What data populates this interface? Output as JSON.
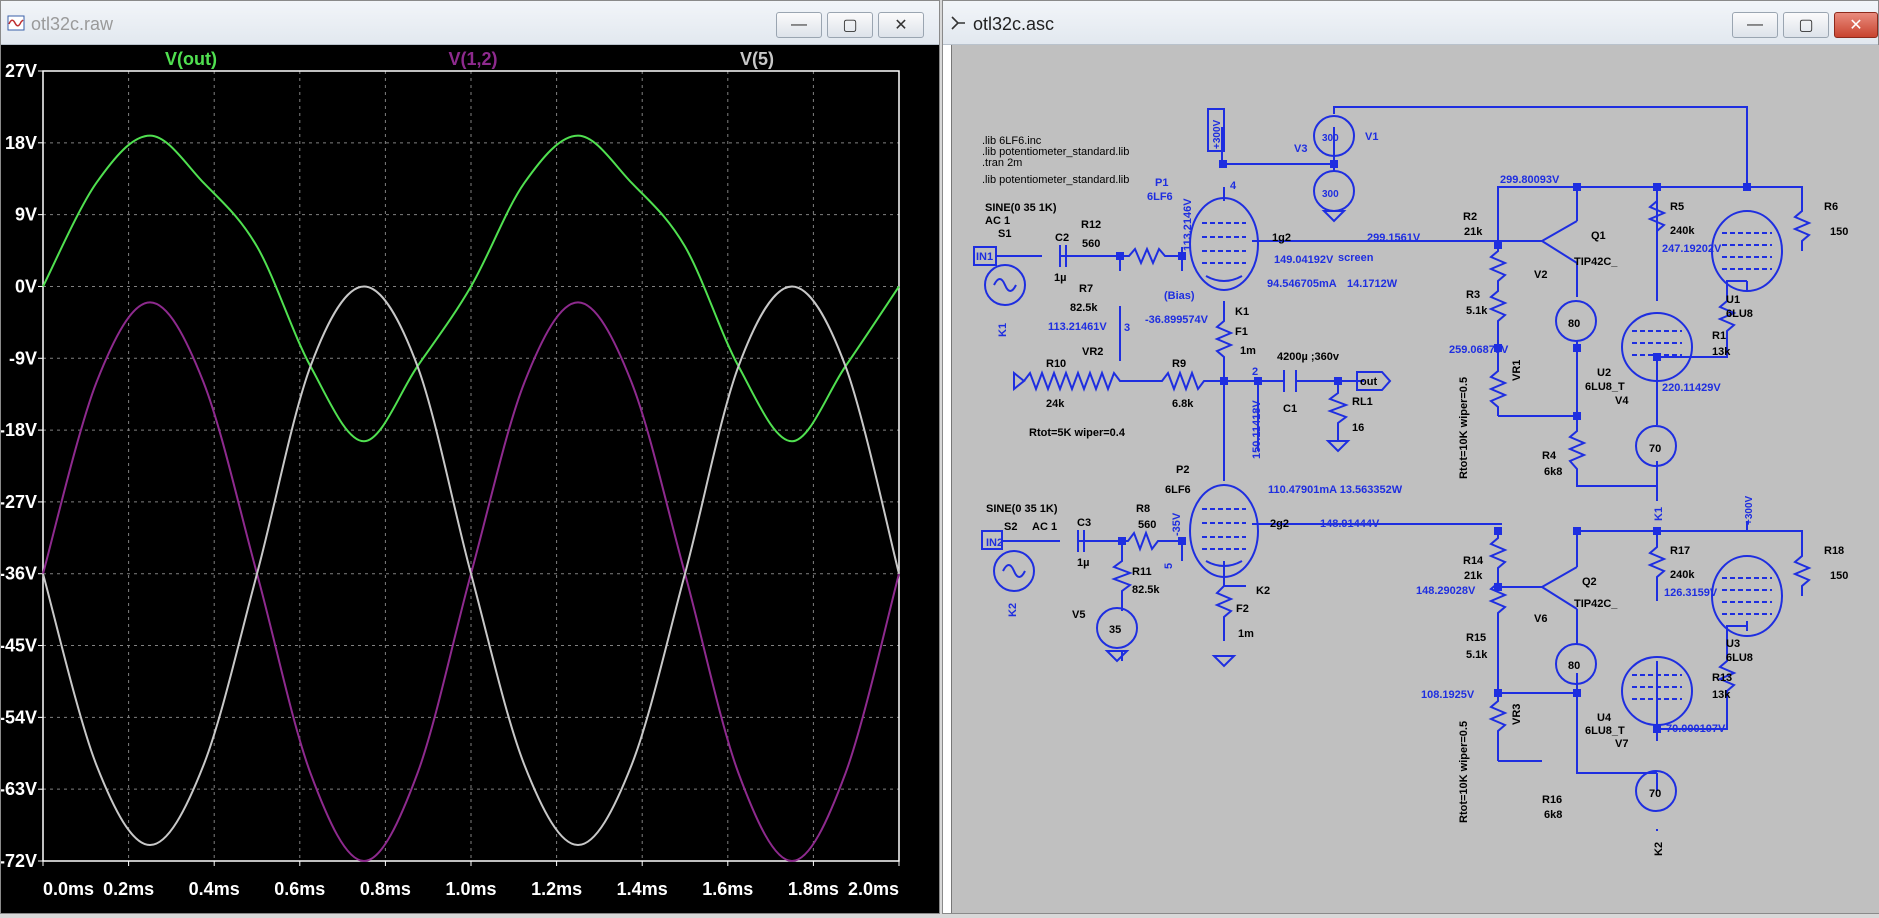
{
  "plot_window": {
    "title": "otl32c.raw",
    "buttons": {
      "minimize": "—",
      "maximize": "▢",
      "close": "✕"
    }
  },
  "schematic_window": {
    "title": "otl32c.asc",
    "buttons": {
      "minimize": "—",
      "maximize": "▢",
      "close": "✕"
    }
  },
  "chart_data": {
    "type": "line",
    "xlabel": "",
    "ylabel": "",
    "xlim": [
      0.0,
      2.0
    ],
    "ylim": [
      -72,
      27
    ],
    "x_tick_labels": [
      "0.0ms",
      "0.2ms",
      "0.4ms",
      "0.6ms",
      "0.8ms",
      "1.0ms",
      "1.2ms",
      "1.4ms",
      "1.6ms",
      "1.8ms",
      "2.0ms"
    ],
    "y_tick_labels": [
      "27V",
      "18V",
      "9V",
      "0V",
      "-9V",
      "-18V",
      "-27V",
      "-36V",
      "-45V",
      "-54V",
      "-63V",
      "-72V"
    ],
    "grid": true,
    "background": "#000000",
    "series": [
      {
        "name": "V(out)",
        "color": "#50e050",
        "x": [
          0.0,
          0.125,
          0.25,
          0.375,
          0.5,
          0.625,
          0.75,
          0.875,
          1.0,
          1.125,
          1.25,
          1.375,
          1.5,
          1.625,
          1.75,
          1.875,
          2.0
        ],
        "values": [
          0,
          13,
          18.9,
          13,
          5,
          -10,
          -19.4,
          -10,
          0,
          13,
          18.9,
          13,
          5,
          -10,
          -19.4,
          -10,
          0
        ]
      },
      {
        "name": "V(1,2)",
        "color": "#8e2a8e",
        "x": [
          0.0,
          0.125,
          0.25,
          0.375,
          0.5,
          0.625,
          0.75,
          0.875,
          1.0,
          1.125,
          1.25,
          1.375,
          1.5,
          1.625,
          1.75,
          1.875,
          2.0
        ],
        "values": [
          -36,
          -12,
          -2,
          -12,
          -36,
          -61,
          -72,
          -61,
          -36,
          -12,
          -2,
          -12,
          -36,
          -61,
          -72,
          -61,
          -36
        ]
      },
      {
        "name": "V(5)",
        "color": "#c8c8c8",
        "x": [
          0.0,
          0.125,
          0.25,
          0.375,
          0.5,
          0.625,
          0.75,
          0.875,
          1.0,
          1.125,
          1.25,
          1.375,
          1.5,
          1.625,
          1.75,
          1.875,
          2.0
        ],
        "values": [
          -36,
          -60,
          -70,
          -60,
          -36,
          -10,
          0,
          -10,
          -36,
          -60,
          -70,
          -60,
          -36,
          -10,
          0,
          -10,
          -36
        ]
      }
    ]
  },
  "schematic": {
    "directives": [
      ".lib 6LF6.inc",
      ".lib potentiometer_standard.lib",
      ".tran 2m",
      ".lib potentiometer_standard.lib"
    ],
    "components": {
      "v1": "V1",
      "v1_val": "300",
      "v3": "V3",
      "v3_val": "300",
      "v300_flag": "+300V",
      "node4": "4",
      "p1": "P1",
      "p1_model": "6LF6",
      "p1_volt": "113.2146V",
      "bias": "(Bias)",
      "sine1": "SINE(0 35 1K)",
      "ac1": "AC 1",
      "s1": "S1",
      "in1": "IN1",
      "k1_flag": "K1",
      "c2": "C2",
      "c2_val": "1µ",
      "r12": "R12",
      "r12_val": "560",
      "r7": "R7",
      "r7_val": "82.5k",
      "v_113": "113.21461V",
      "node3": "3",
      "v_neg36": "-36.899574V",
      "vr2": "VR2",
      "r10": "R10",
      "r10_val": "24k",
      "r9": "R9",
      "r9_val": "6.8k",
      "rtot5k": "Rtot=5K wiper=0.4",
      "g1": "1g2",
      "v_299": "299.1561V",
      "v_149": "149.04192V",
      "screen": "screen",
      "i_94": "94.546705mA",
      "w_14": "14.1712W",
      "k1": "K1",
      "f1": "F1",
      "f1_val": "1m",
      "c1_label": "4200µ ;360v",
      "c1": "C1",
      "node2": "2",
      "out": "out",
      "rl1": "RL1",
      "rl1_val": "16",
      "v_150": "150.11418V",
      "p2": "P2",
      "p2_model": "6LF6",
      "i_110": "110.47901mA 13.563352W",
      "sine2": "SINE(0 35 1K)",
      "s2": "S2",
      "ac2": "AC 1",
      "in2": "IN2",
      "k2_flag": "K2",
      "c3": "C3",
      "c3_val": "1µ",
      "r8": "R8",
      "r8_val": "560",
      "neg35": "-35V",
      "r11": "R11",
      "r11_val": "82.5k",
      "v5": "V5",
      "v5_val": "35",
      "node5": "5",
      "g2": "2g2",
      "v_148": "148.91444V",
      "k2": "K2",
      "f2": "F2",
      "f2_val": "1m",
      "v_29980": "299.80093V",
      "r2": "R2",
      "r2_val": "21k",
      "q1": "Q1",
      "tip1": "TIP42C_",
      "v2": "V2",
      "r3": "R3",
      "r3_val": "5.1k",
      "v80a": "80",
      "v_259": "259.06879V",
      "vr1": "VR1",
      "rtot10k_a": "Rtot=10K wiper=0.5",
      "u2": "U2",
      "u2_model": "6LU8_T",
      "v4": "V4",
      "r4": "R4",
      "r4_val": "6k8",
      "v70a": "70",
      "r5": "R5",
      "r5_val": "240k",
      "v_247": "247.19202V",
      "r6": "R6",
      "r6_val": "150",
      "u1": "U1",
      "u1_model": "6LU8",
      "r1": "R1",
      "r1_val": "13k",
      "v_220": "220.11429V",
      "k1b": "K1",
      "v300b": "+300V",
      "r14": "R14",
      "r14_val": "21k",
      "v_148b": "148.29028V",
      "q2": "Q2",
      "tip2": "TIP42C_",
      "v6": "V6",
      "r15": "R15",
      "r15_val": "5.1k",
      "v80b": "80",
      "v_108": "108.1925V",
      "vr3": "VR3",
      "rtot10k_b": "Rtot=10K wiper=0.5",
      "u4": "U4",
      "u4_model": "6LU8_T",
      "v7": "V7",
      "v_70": "70.000107V",
      "r16": "R16",
      "r16_val": "6k8",
      "v70b": "70",
      "k2b": "K2",
      "r17": "R17",
      "r17_val": "240k",
      "v_126": "126.3159V",
      "r18": "R18",
      "r18_val": "150",
      "u3": "U3",
      "u3_model": "6LU8",
      "r13": "R13",
      "r13_val": "13k"
    }
  }
}
